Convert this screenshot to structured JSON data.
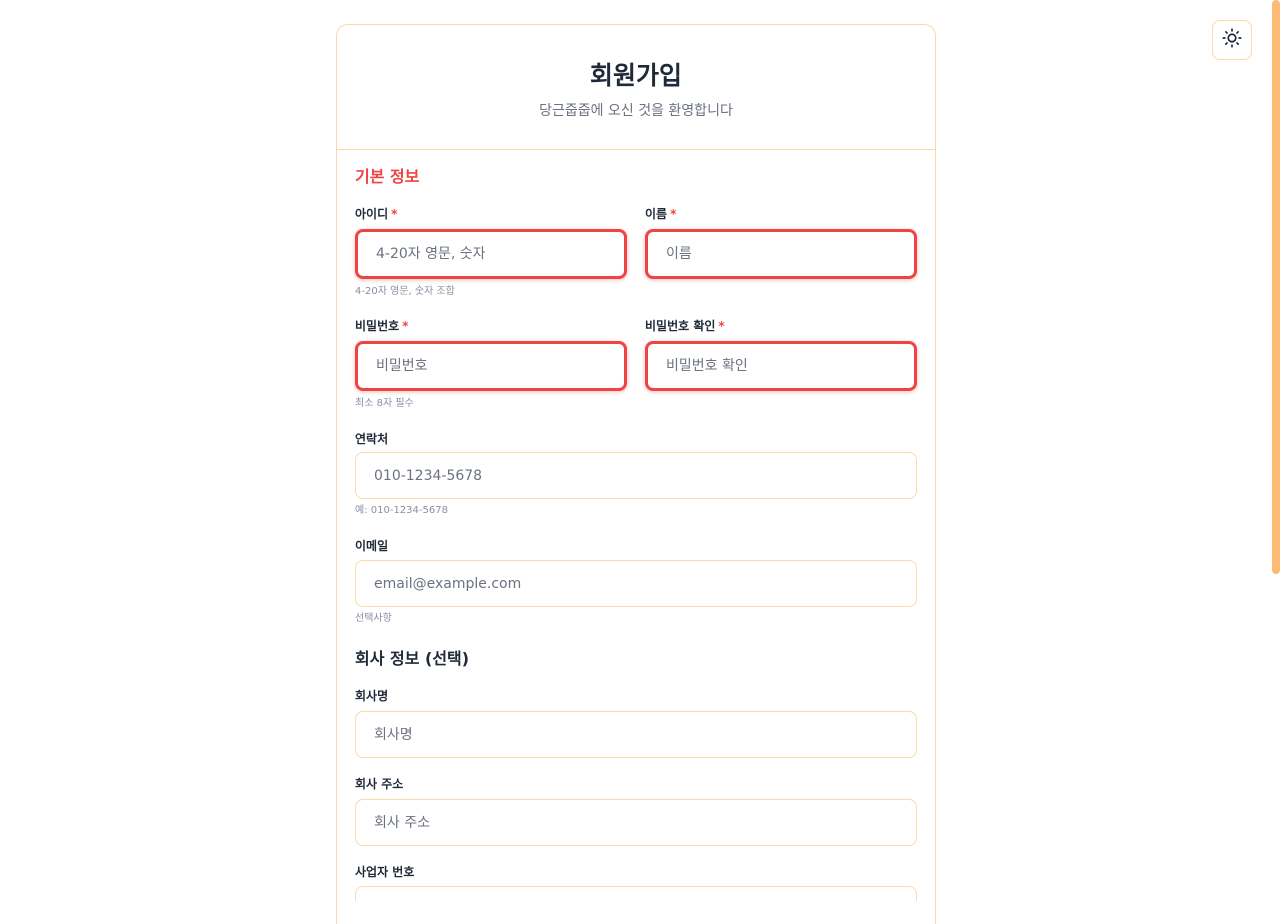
{
  "theme_toggle": {
    "icon": "sun-icon"
  },
  "header": {
    "title": "회원가입",
    "subtitle": "당근줍줍에 오신 것을 환영합니다"
  },
  "basic_section": {
    "title": "기본 정보",
    "required_mark": "*",
    "fields": {
      "username": {
        "label": "아이디",
        "placeholder": "4-20자 영문, 숫자",
        "hint": "4-20자 영문, 숫자 조합"
      },
      "name": {
        "label": "이름",
        "placeholder": "이름"
      },
      "password": {
        "label": "비밀번호",
        "placeholder": "비밀번호",
        "hint": "최소 8자 필수"
      },
      "password_confirm": {
        "label": "비밀번호 확인",
        "placeholder": "비밀번호 확인"
      },
      "phone": {
        "label": "연락처",
        "placeholder": "010-1234-5678",
        "hint": "예: 010-1234-5678"
      },
      "email": {
        "label": "이메일",
        "placeholder": "email@example.com",
        "hint": "선택사항"
      }
    }
  },
  "company_section": {
    "title": "회사 정보 (선택)",
    "fields": {
      "company_name": {
        "label": "회사명",
        "placeholder": "회사명"
      },
      "company_address": {
        "label": "회사 주소",
        "placeholder": "회사 주소"
      },
      "business_number": {
        "label": "사업자 번호",
        "placeholder": ""
      }
    }
  },
  "colors": {
    "accent": "#ef4444",
    "border": "#fcd9a8",
    "scrollbar": "#fdba74"
  }
}
